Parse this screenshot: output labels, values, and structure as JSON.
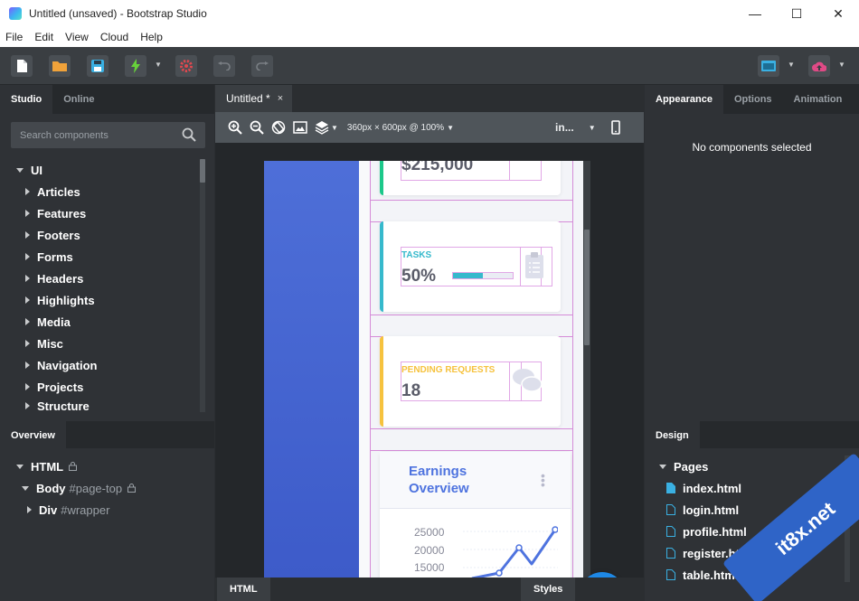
{
  "window": {
    "title": "Untitled (unsaved) - Bootstrap Studio",
    "minimize": "—",
    "maximize": "☐",
    "close": "✕"
  },
  "menu": [
    "File",
    "Edit",
    "View",
    "Cloud",
    "Help"
  ],
  "toolbar": {
    "buttons": [
      "new-file-icon",
      "open-folder-icon",
      "save-icon",
      "export-icon",
      "settings-icon",
      "undo-icon",
      "redo-icon",
      "preview-icon",
      "publish-icon"
    ],
    "colors": {
      "open": "#f0a23a",
      "save": "#3ab0e2",
      "export": "#67d23a",
      "settings": "#e0484f",
      "preview": "#3ab0e2",
      "publish": "#e04a86"
    }
  },
  "left_panel": {
    "tabs": [
      {
        "label": "Studio",
        "active": true
      },
      {
        "label": "Online",
        "active": false
      }
    ],
    "search_placeholder": "Search components",
    "root": "UI",
    "items": [
      "Articles",
      "Features",
      "Footers",
      "Forms",
      "Headers",
      "Highlights",
      "Media",
      "Misc",
      "Navigation",
      "Projects",
      "Structure"
    ]
  },
  "overview": {
    "tab": "Overview",
    "html_label": "HTML",
    "body_label": "Body",
    "body_id": "#page-top",
    "div_label": "Div",
    "div_id": "#wrapper"
  },
  "editor": {
    "doc_tab": "Untitled *",
    "doc_tab_close": "×",
    "viewport_label": "360px × 600px @ 100%",
    "breakpoint_label": "in...",
    "preview": {
      "earnings_card_value": "$215,000",
      "tasks_label": "TASKS",
      "tasks_value": "50%",
      "tasks_progress": 0.5,
      "pending_label": "PENDING REQUESTS",
      "pending_value": "18",
      "chart_title": "Earnings Overview",
      "chart_ticks": [
        "25000",
        "20000",
        "15000"
      ],
      "colors": {
        "sidebar": "#4e6fd8",
        "tasks": "#36b9cc",
        "pending": "#f6c23e",
        "earnings": "#1cc88a",
        "title": "#4e73df"
      }
    },
    "fab_label": "+",
    "bottom_tabs": {
      "left": "HTML",
      "right": "Styles"
    }
  },
  "right_panel": {
    "tabs": [
      {
        "label": "Appearance",
        "active": true
      },
      {
        "label": "Options",
        "active": false
      },
      {
        "label": "Animation",
        "active": false
      }
    ],
    "empty_message": "No components selected",
    "design_tab": "Design",
    "pages_label": "Pages",
    "pages": [
      "index.html",
      "login.html",
      "profile.html",
      "register.html",
      "table.html"
    ]
  },
  "watermark": "it8x.net"
}
